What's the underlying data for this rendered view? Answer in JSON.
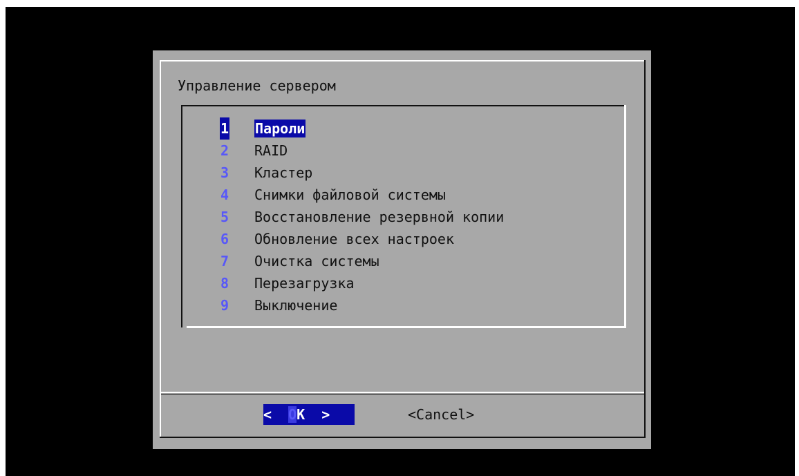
{
  "dialog": {
    "title": "Управление сервером"
  },
  "menu": {
    "items": [
      {
        "key": "1",
        "label": "Пароли",
        "selected": true
      },
      {
        "key": "2",
        "label": "RAID"
      },
      {
        "key": "3",
        "label": "Кластер"
      },
      {
        "key": "4",
        "label": "Снимки файловой системы"
      },
      {
        "key": "5",
        "label": "Восстановление резервной копии"
      },
      {
        "key": "6",
        "label": "Обновление всех настроек"
      },
      {
        "key": "7",
        "label": "Очистка системы"
      },
      {
        "key": "8",
        "label": "Перезагрузка"
      },
      {
        "key": "9",
        "label": "Выключение"
      }
    ]
  },
  "buttons": {
    "ok_left": "<  ",
    "ok_hotkey": "O",
    "ok_rest": "K  >",
    "cancel_label": "<Cancel>"
  },
  "colors": {
    "screen_background": "#000000",
    "dialog_background": "#a8a8a8",
    "selection": "#0a0aa8",
    "hotkey": "#5858f8"
  }
}
